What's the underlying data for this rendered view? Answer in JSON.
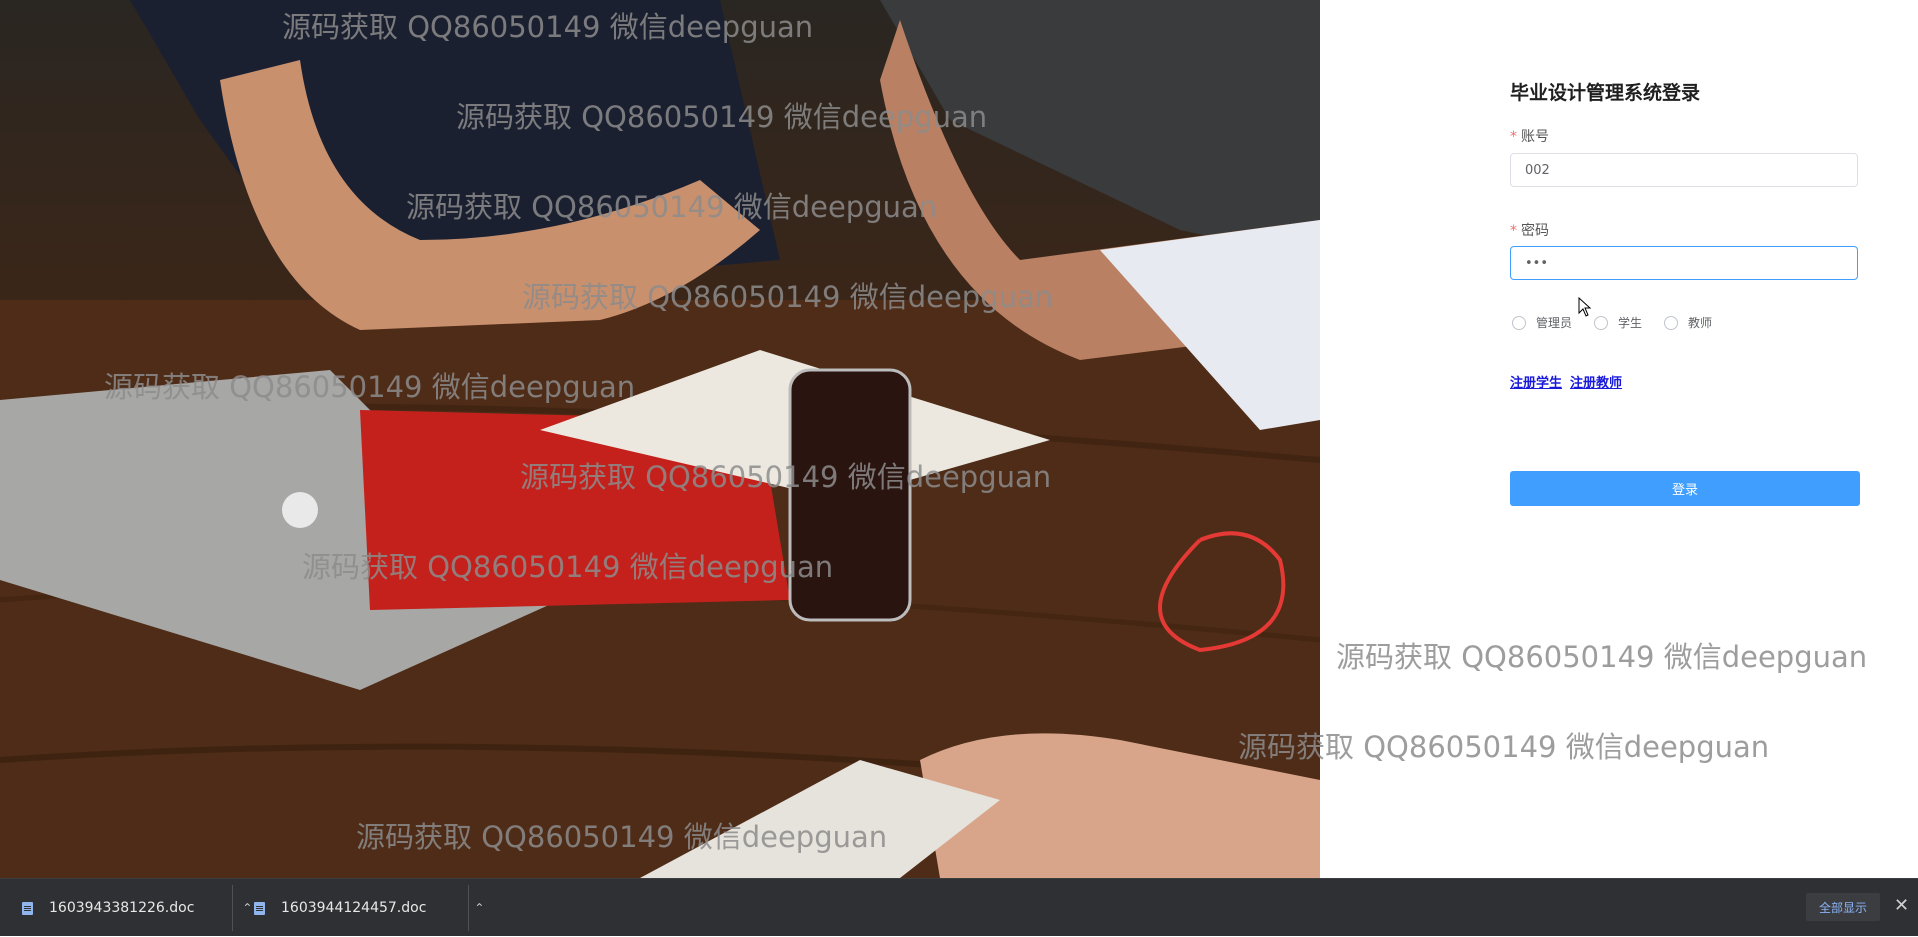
{
  "login": {
    "title": "毕业设计管理系统登录",
    "account_label": "账号",
    "account_value": "002",
    "password_label": "密码",
    "password_value": "•••",
    "required_mark": "*",
    "roles": [
      "管理员",
      "学生",
      "教师"
    ],
    "register_student": "注册学生",
    "register_teacher": "注册教师",
    "login_button": "登录"
  },
  "watermark": "源码获取 QQ86050149 微信deepguan",
  "downloads": {
    "items": [
      {
        "filename": "1603943381226.doc"
      },
      {
        "filename": "1603944124457.doc"
      }
    ],
    "show_all": "全部显示",
    "close": "✕"
  },
  "colors": {
    "accent": "#409eff",
    "required": "#f56c6c",
    "link": "#1a1adb",
    "download_bar": "#2f3033"
  }
}
